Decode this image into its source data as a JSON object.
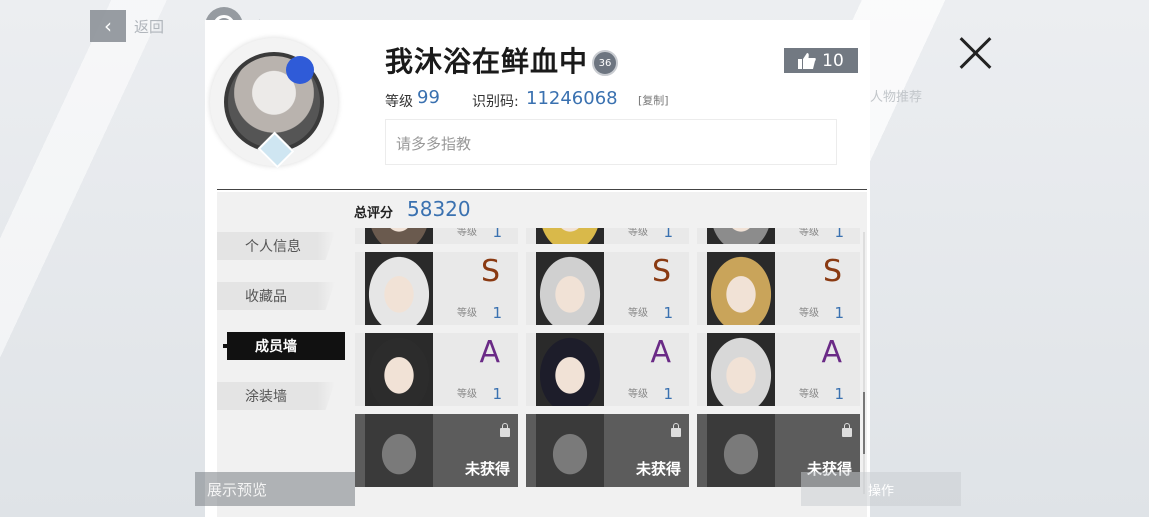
{
  "topbar": {
    "back_label": "返回",
    "home_label": "主界面"
  },
  "profile": {
    "name": "我沐浴在鲜血中",
    "badge_text": "36",
    "like_count": "10",
    "level_label": "等级",
    "level_value": "99",
    "uid_label": "识别码:",
    "uid_value": "11246068",
    "copy_label": "[复制]",
    "signature_placeholder": "请多多指教",
    "ghost_text": "人物推荐"
  },
  "sidebar": {
    "items": [
      {
        "label": "个人信息",
        "active": false
      },
      {
        "label": "收藏品",
        "active": false
      },
      {
        "label": "成员墙",
        "active": true
      },
      {
        "label": "涂装墙",
        "active": false
      }
    ]
  },
  "score": {
    "label": "总评分",
    "value": "58320"
  },
  "members": {
    "level_label": "等级",
    "locked_label": "未获得",
    "rows": [
      [
        {
          "rank": "",
          "level": "1",
          "locked": false
        },
        {
          "rank": "",
          "level": "1",
          "locked": false
        },
        {
          "rank": "",
          "level": "1",
          "locked": false
        }
      ],
      [
        {
          "rank": "S",
          "level": "1",
          "locked": false
        },
        {
          "rank": "S",
          "level": "1",
          "locked": false
        },
        {
          "rank": "S",
          "level": "1",
          "locked": false
        }
      ],
      [
        {
          "rank": "A",
          "level": "1",
          "locked": false
        },
        {
          "rank": "A",
          "level": "1",
          "locked": false
        },
        {
          "rank": "A",
          "level": "1",
          "locked": false
        }
      ],
      [
        {
          "rank": "",
          "level": "",
          "locked": true
        },
        {
          "rank": "",
          "level": "",
          "locked": true
        },
        {
          "rank": "",
          "level": "",
          "locked": true
        }
      ]
    ]
  },
  "footer": {
    "preview_label": "展示预览",
    "right_label": "操作"
  },
  "colors": {
    "accent_blue": "#3a71b0",
    "rank_s": "#8a3a12",
    "rank_a": "#6a2a86"
  }
}
